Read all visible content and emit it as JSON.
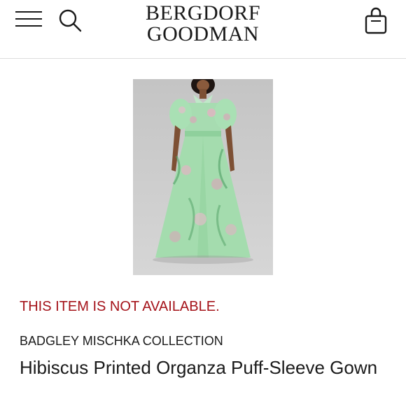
{
  "header": {
    "logo_line1": "BERGDORF",
    "logo_line2": "GOODMAN",
    "icons": {
      "menu": "hamburger-menu-icon",
      "search": "search-icon",
      "bag": "shopping-bag-icon"
    }
  },
  "product": {
    "availability": "THIS ITEM IS NOT AVAILABLE.",
    "availability_color": "#a41219",
    "designer": "BADGLEY MISCHKA COLLECTION",
    "name": "Hibiscus Printed Organza Puff-Sleeve Gown"
  }
}
